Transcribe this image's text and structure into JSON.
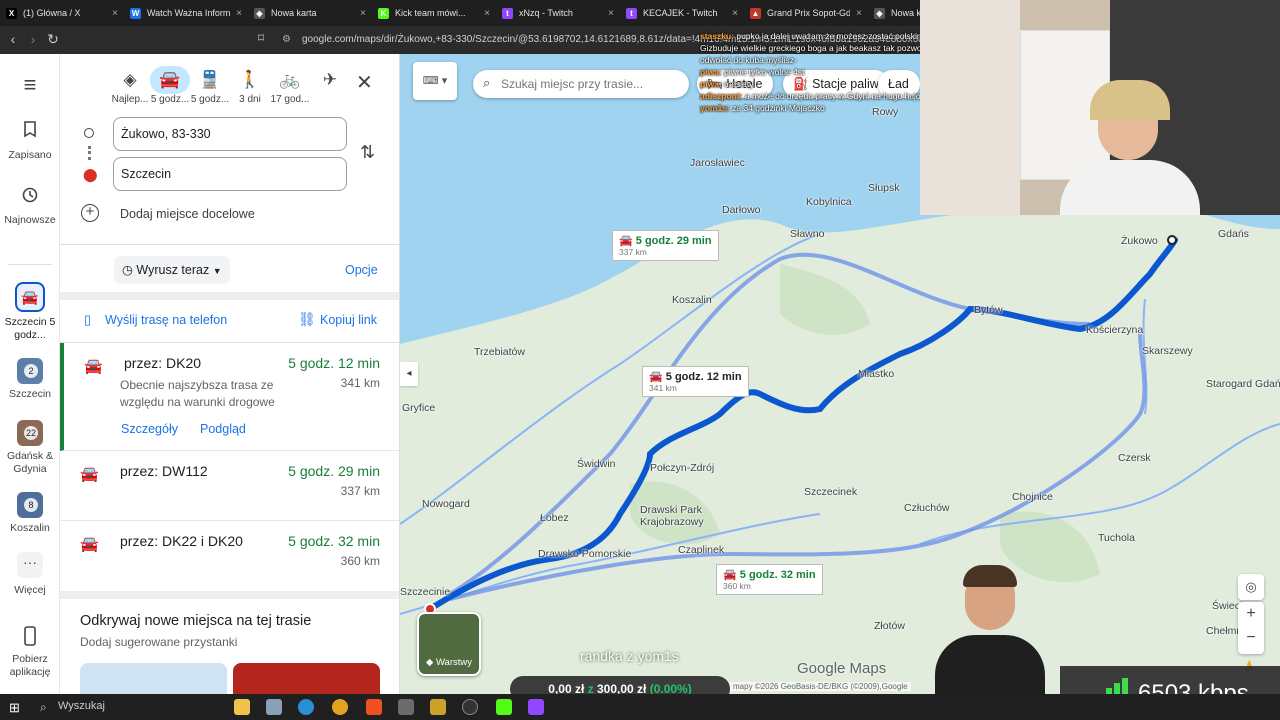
{
  "tabs": [
    {
      "label": "(1) Główna / X",
      "icon": "x-icon",
      "color": "#000000",
      "glyph": "X"
    },
    {
      "label": "Watch Ważna Informacja",
      "icon": "watch-icon",
      "color": "#1a73e8",
      "glyph": "W"
    },
    {
      "label": "Nowa karta",
      "icon": "shield-icon",
      "color": "#555555",
      "glyph": "◈"
    },
    {
      "label": "Kick team mówi...",
      "icon": "kick-icon",
      "color": "#53fc18",
      "glyph": "K"
    },
    {
      "label": "xNzq - Twitch",
      "icon": "twitch-icon",
      "color": "#9146ff",
      "glyph": "t"
    },
    {
      "label": "KECAJEK - Twitch",
      "icon": "twitch-icon",
      "color": "#9146ff",
      "glyph": "t"
    },
    {
      "label": "Grand Prix Sopot-Gdynia",
      "icon": "race-icon",
      "color": "#c0392b",
      "glyph": "▲"
    },
    {
      "label": "Nowa k",
      "icon": "shield-icon",
      "color": "#555555",
      "glyph": "◈"
    }
  ],
  "url": "google.com/maps/dir/Żukowo,+83-330/Szczecin/@53.6198702,14.6121689,8.61z/data=!4m16!4m15!1m5!1m1!1s0x46fd8a1902a94e8b0x68f6...",
  "rail": {
    "menu_icon": "≡",
    "saved": "Zapisano",
    "recent": "Najnowsze",
    "current": "Szczecin 5 godz...",
    "items": [
      {
        "label": "Szczecin",
        "count": "2",
        "color": "#5b7fa8"
      },
      {
        "label": "Gdańsk & Gdynia",
        "count": "22",
        "color": "#8a6a56"
      },
      {
        "label": "Koszalin",
        "count": "8",
        "color": "#4d6f9a"
      }
    ],
    "more": "Więcej",
    "app": "Pobierz aplikację"
  },
  "modes": [
    {
      "name": "best",
      "label": "Najlep...",
      "icon": "◈"
    },
    {
      "name": "car",
      "label": "5 godz...",
      "icon": "🚘"
    },
    {
      "name": "transit",
      "label": "5 godz...",
      "icon": "🚆"
    },
    {
      "name": "walk",
      "label": "3 dni",
      "icon": "🚶"
    },
    {
      "name": "bike",
      "label": "17 god...",
      "icon": "🚲"
    },
    {
      "name": "flight",
      "label": "",
      "icon": "✈"
    }
  ],
  "origin": "Żukowo, 83-330",
  "destination": "Szczecin",
  "add_destination": "Dodaj miejsce docelowe",
  "depart": "Wyrusz teraz",
  "options": "Opcje",
  "send_to_phone": "Wyślij trasę na telefon",
  "copy_link": "Kopiuj link",
  "routes": [
    {
      "via": "przez: DK20",
      "time": "5 godz. 12 min",
      "km": "341 km",
      "note": "Obecnie najszybsza trasa ze względu na warunki drogowe",
      "details": "Szczegóły",
      "preview": "Podgląd"
    },
    {
      "via": "przez: DW112",
      "time": "5 godz. 29 min",
      "km": "337 km"
    },
    {
      "via": "przez: DK22 i DK20",
      "time": "5 godz. 32 min",
      "km": "360 km"
    }
  ],
  "discover_title": "Odkrywaj nowe miejsca na tej trasie",
  "discover_sub": "Dodaj sugerowane przystanki",
  "map": {
    "search_placeholder": "Szukaj miejsc przy trasie...",
    "chips": [
      "Hotele",
      "Stacje paliw",
      "Ład"
    ],
    "layers": "Warstwy",
    "logo": "Google Maps",
    "attribution": "mapy ©2026 GeoBasis-DE/BKG (©2009),Google",
    "towns": [
      "Rowy",
      "Jarosławiec",
      "Słupsk",
      "Darłowo",
      "Kobylnica",
      "Sławno",
      "Żukowo",
      "Koszalin",
      "Bytów",
      "Kościerzyna",
      "Trzebiatów",
      "Skarszewy",
      "Miastko",
      "Gryfice",
      "Starogard Gdański",
      "Czersk",
      "Połczyn-Zdrój",
      "Świdwin",
      "Drawski Park Krajobrazowy",
      "Szczecinek",
      "Człuchów",
      "Chojnice",
      "Nowogard",
      "Łobez",
      "Tuchola",
      "Drawsko Pomorskie",
      "Czaplinek",
      "Szczecinie",
      "Świecie",
      "Chełmno",
      "Złotów",
      "Gdańs"
    ],
    "labels": [
      {
        "time": "5 godz. 29 min",
        "km": "337 km"
      },
      {
        "time": "5 godz. 12 min",
        "km": "341 km"
      },
      {
        "time": "5 godz. 32 min",
        "km": "360 km"
      }
    ]
  },
  "stream": {
    "chat": [
      {
        "user": "staszku:",
        "text": "pupko ja dalej uważam że możesz zostać polskim slavicAfarem ja Gizbuduje wielkie greckiego boga a jak beakasz tak pozwol to mi sie jakos odwołać do kuba myślisz-"
      },
      {
        "user": "piwa:",
        "text": "piwne tylko wolne 4st"
      },
      {
        "user": "piwa:",
        "text": "mesiety"
      },
      {
        "user": "adiszpont:",
        "text": "a może do urzędu pracy w Gdyni na hugo hujojtaja"
      },
      {
        "user": "yom1s:",
        "text": "za 34 godzinki Mojaczko"
      }
    ],
    "banner": "randka z yom1s",
    "donation_current": "0,00 zł",
    "donation_sep": "z",
    "donation_goal": "300,00 zł",
    "donation_pct": "(0.00%)",
    "bitrate": "6503 kbps"
  },
  "taskbar": {
    "search": "Wyszukaj"
  }
}
